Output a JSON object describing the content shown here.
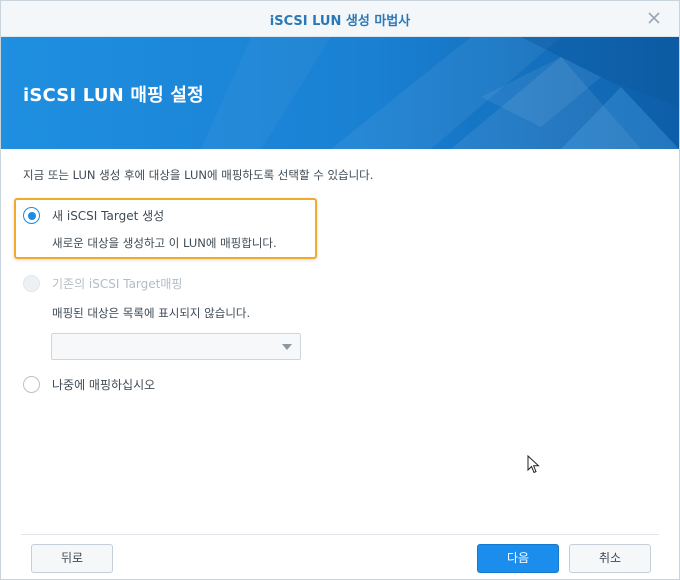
{
  "window": {
    "title": "iSCSI LUN 생성 마법사"
  },
  "banner": {
    "heading": "iSCSI LUN 매핑 설정"
  },
  "content": {
    "description": "지금 또는 LUN 생성 후에 대상을 LUN에 매핑하도록 선택할 수 있습니다.",
    "options": [
      {
        "label": "새 iSCSI Target 생성",
        "sublabel": "새로운 대상을 생성하고 이 LUN에 매핑합니다.",
        "checked": true,
        "disabled": false
      },
      {
        "label": "기존의 iSCSI Target매핑",
        "sublabel": "매핑된 대상은 목록에 표시되지 않습니다.",
        "checked": false,
        "disabled": true
      },
      {
        "label": "나중에 매핑하십시오",
        "checked": false,
        "disabled": false
      }
    ],
    "target_select": {
      "value": ""
    }
  },
  "footer": {
    "back_label": "뒤로",
    "next_label": "다음",
    "cancel_label": "취소"
  },
  "colors": {
    "accent": "#1a8ce6",
    "highlight": "#f0ab2c",
    "banner": "#1a86d8"
  }
}
